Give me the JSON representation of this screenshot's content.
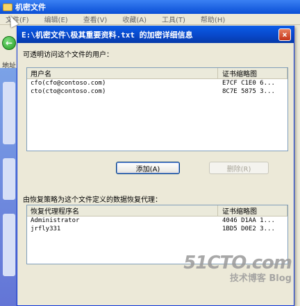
{
  "explorer": {
    "title": "机密文件",
    "menu": [
      "文件(F)",
      "编辑(E)",
      "查看(V)",
      "收藏(A)",
      "工具(T)",
      "帮助(H)"
    ],
    "address_label": "地址"
  },
  "dialog": {
    "title": "E:\\机密文件\\极其重要资料.txt 的加密详细信息",
    "users_label": "可透明访问这个文件的用户：",
    "users_columns": [
      "用户名",
      "证书缩略图"
    ],
    "users": [
      {
        "name": "cfo(cfo@contoso.com)",
        "thumb": "E7CF C1E0 6..."
      },
      {
        "name": "cto(cto@contoso.com)",
        "thumb": "8C7E 5875 3..."
      }
    ],
    "add_button": "添加(A)",
    "remove_button": "删除(R)",
    "recovery_label": "由恢复策略为这个文件定义的数据恢复代理：",
    "recovery_columns": [
      "恢复代理程序名",
      "证书缩略图"
    ],
    "agents": [
      {
        "name": "Administrator",
        "thumb": "4046 D1AA 1..."
      },
      {
        "name": "jrfly331",
        "thumb": "1BD5 D0E2 3..."
      }
    ]
  },
  "watermark": {
    "line1": "51CTO.com",
    "line2": "技术博客 Blog"
  }
}
